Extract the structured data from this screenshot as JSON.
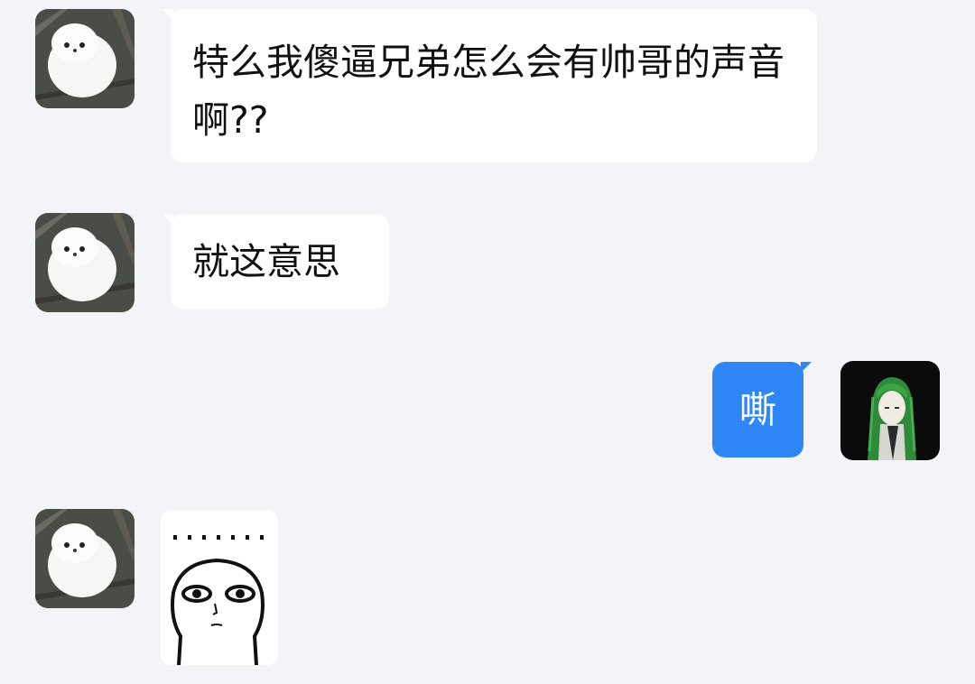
{
  "messages": [
    {
      "sender": "friend",
      "text": "特么我傻逼兄弟怎么会有帅哥的声音啊??"
    },
    {
      "sender": "friend",
      "text": "就这意思"
    },
    {
      "sender": "me",
      "text": "嘶"
    },
    {
      "sender": "friend",
      "type": "sticker",
      "sticker": "staring-meme-sticker",
      "text": "·······"
    }
  ],
  "colors": {
    "background": "#f3f4f8",
    "incoming_bubble": "#ffffff",
    "outgoing_bubble": "#2f86f6"
  },
  "icons": {
    "friend_avatar": "white-bird-avatar",
    "my_avatar": "green-haired-anime-avatar"
  }
}
